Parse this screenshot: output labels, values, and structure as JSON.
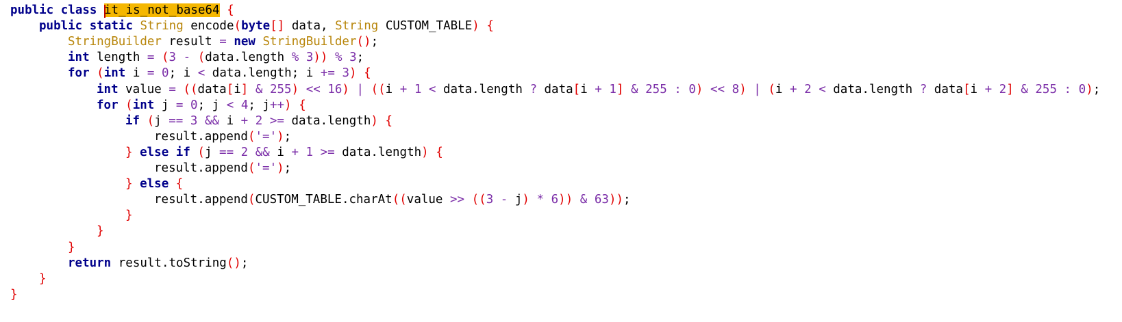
{
  "editor": {
    "lines": [
      {
        "indent": 0,
        "tokens": [
          [
            "kw",
            "public"
          ],
          [
            "id",
            " "
          ],
          [
            "kw",
            "class"
          ],
          [
            "id",
            " "
          ],
          [
            "hl",
            "it_is_not_base64"
          ],
          [
            "id",
            " "
          ],
          [
            "p",
            "{"
          ]
        ]
      },
      {
        "indent": 1,
        "tokens": [
          [
            "kw",
            "public"
          ],
          [
            "id",
            " "
          ],
          [
            "kw",
            "static"
          ],
          [
            "id",
            " "
          ],
          [
            "type",
            "String"
          ],
          [
            "id",
            " encode"
          ],
          [
            "p",
            "("
          ],
          [
            "kw",
            "byte"
          ],
          [
            "p",
            "[]"
          ],
          [
            "id",
            " data, "
          ],
          [
            "type",
            "String"
          ],
          [
            "id",
            " CUSTOM_TABLE"
          ],
          [
            "p",
            ")"
          ],
          [
            "id",
            " "
          ],
          [
            "p",
            "{"
          ]
        ]
      },
      {
        "indent": 2,
        "tokens": [
          [
            "type",
            "StringBuilder"
          ],
          [
            "id",
            " result "
          ],
          [
            "op",
            "="
          ],
          [
            "id",
            " "
          ],
          [
            "kw",
            "new"
          ],
          [
            "id",
            " "
          ],
          [
            "type",
            "StringBuilder"
          ],
          [
            "p",
            "()"
          ],
          [
            "id",
            ";"
          ]
        ]
      },
      {
        "indent": 2,
        "tokens": [
          [
            "kw",
            "int"
          ],
          [
            "id",
            " length "
          ],
          [
            "op",
            "="
          ],
          [
            "id",
            " "
          ],
          [
            "p",
            "("
          ],
          [
            "num",
            "3"
          ],
          [
            "id",
            " "
          ],
          [
            "op",
            "-"
          ],
          [
            "id",
            " "
          ],
          [
            "p",
            "("
          ],
          [
            "id",
            "data.length "
          ],
          [
            "op",
            "%"
          ],
          [
            "id",
            " "
          ],
          [
            "num",
            "3"
          ],
          [
            "p",
            "))"
          ],
          [
            "id",
            " "
          ],
          [
            "op",
            "%"
          ],
          [
            "id",
            " "
          ],
          [
            "num",
            "3"
          ],
          [
            "id",
            ";"
          ]
        ]
      },
      {
        "indent": 2,
        "tokens": [
          [
            "kw",
            "for"
          ],
          [
            "id",
            " "
          ],
          [
            "p",
            "("
          ],
          [
            "kw",
            "int"
          ],
          [
            "id",
            " i "
          ],
          [
            "op",
            "="
          ],
          [
            "id",
            " "
          ],
          [
            "num",
            "0"
          ],
          [
            "id",
            "; i "
          ],
          [
            "op",
            "<"
          ],
          [
            "id",
            " data.length; i "
          ],
          [
            "op",
            "+="
          ],
          [
            "id",
            " "
          ],
          [
            "num",
            "3"
          ],
          [
            "p",
            ")"
          ],
          [
            "id",
            " "
          ],
          [
            "p",
            "{"
          ]
        ]
      },
      {
        "indent": 3,
        "tokens": [
          [
            "kw",
            "int"
          ],
          [
            "id",
            " value "
          ],
          [
            "op",
            "="
          ],
          [
            "id",
            " "
          ],
          [
            "p",
            "(("
          ],
          [
            "id",
            "data"
          ],
          [
            "p",
            "["
          ],
          [
            "id",
            "i"
          ],
          [
            "p",
            "]"
          ],
          [
            "id",
            " "
          ],
          [
            "op",
            "&"
          ],
          [
            "id",
            " "
          ],
          [
            "num",
            "255"
          ],
          [
            "p",
            ")"
          ],
          [
            "id",
            " "
          ],
          [
            "op",
            "<<"
          ],
          [
            "id",
            " "
          ],
          [
            "num",
            "16"
          ],
          [
            "p",
            ")"
          ],
          [
            "id",
            " "
          ],
          [
            "op",
            "|"
          ],
          [
            "id",
            " "
          ],
          [
            "p",
            "(("
          ],
          [
            "id",
            "i "
          ],
          [
            "op",
            "+"
          ],
          [
            "id",
            " "
          ],
          [
            "num",
            "1"
          ],
          [
            "id",
            " "
          ],
          [
            "op",
            "<"
          ],
          [
            "id",
            " data.length "
          ],
          [
            "op",
            "?"
          ],
          [
            "id",
            " data"
          ],
          [
            "p",
            "["
          ],
          [
            "id",
            "i "
          ],
          [
            "op",
            "+"
          ],
          [
            "id",
            " "
          ],
          [
            "num",
            "1"
          ],
          [
            "p",
            "]"
          ],
          [
            "id",
            " "
          ],
          [
            "op",
            "&"
          ],
          [
            "id",
            " "
          ],
          [
            "num",
            "255"
          ],
          [
            "id",
            " "
          ],
          [
            "op",
            ":"
          ],
          [
            "id",
            " "
          ],
          [
            "num",
            "0"
          ],
          [
            "p",
            ")"
          ],
          [
            "id",
            " "
          ],
          [
            "op",
            "<<"
          ],
          [
            "id",
            " "
          ],
          [
            "num",
            "8"
          ],
          [
            "p",
            ")"
          ],
          [
            "id",
            " "
          ],
          [
            "op",
            "|"
          ],
          [
            "id",
            " "
          ],
          [
            "p",
            "("
          ],
          [
            "id",
            "i "
          ],
          [
            "op",
            "+"
          ],
          [
            "id",
            " "
          ],
          [
            "num",
            "2"
          ],
          [
            "id",
            " "
          ],
          [
            "op",
            "<"
          ],
          [
            "id",
            " data.length "
          ],
          [
            "op",
            "?"
          ],
          [
            "id",
            " data"
          ],
          [
            "p",
            "["
          ],
          [
            "id",
            "i "
          ],
          [
            "op",
            "+"
          ],
          [
            "id",
            " "
          ],
          [
            "num",
            "2"
          ],
          [
            "p",
            "]"
          ],
          [
            "id",
            " "
          ],
          [
            "op",
            "&"
          ],
          [
            "id",
            " "
          ],
          [
            "num",
            "255"
          ],
          [
            "id",
            " "
          ],
          [
            "op",
            ":"
          ],
          [
            "id",
            " "
          ],
          [
            "num",
            "0"
          ],
          [
            "p",
            ")"
          ],
          [
            "id",
            ";"
          ]
        ]
      },
      {
        "indent": 3,
        "tokens": [
          [
            "kw",
            "for"
          ],
          [
            "id",
            " "
          ],
          [
            "p",
            "("
          ],
          [
            "kw",
            "int"
          ],
          [
            "id",
            " j "
          ],
          [
            "op",
            "="
          ],
          [
            "id",
            " "
          ],
          [
            "num",
            "0"
          ],
          [
            "id",
            "; j "
          ],
          [
            "op",
            "<"
          ],
          [
            "id",
            " "
          ],
          [
            "num",
            "4"
          ],
          [
            "id",
            "; j"
          ],
          [
            "op",
            "++"
          ],
          [
            "p",
            ")"
          ],
          [
            "id",
            " "
          ],
          [
            "p",
            "{"
          ]
        ]
      },
      {
        "indent": 4,
        "tokens": [
          [
            "kw",
            "if"
          ],
          [
            "id",
            " "
          ],
          [
            "p",
            "("
          ],
          [
            "id",
            "j "
          ],
          [
            "op",
            "=="
          ],
          [
            "id",
            " "
          ],
          [
            "num",
            "3"
          ],
          [
            "id",
            " "
          ],
          [
            "op",
            "&&"
          ],
          [
            "id",
            " i "
          ],
          [
            "op",
            "+"
          ],
          [
            "id",
            " "
          ],
          [
            "num",
            "2"
          ],
          [
            "id",
            " "
          ],
          [
            "op",
            ">="
          ],
          [
            "id",
            " data.length"
          ],
          [
            "p",
            ")"
          ],
          [
            "id",
            " "
          ],
          [
            "p",
            "{"
          ]
        ]
      },
      {
        "indent": 5,
        "tokens": [
          [
            "id",
            "result.append"
          ],
          [
            "p",
            "("
          ],
          [
            "str",
            "'='"
          ],
          [
            "p",
            ")"
          ],
          [
            "id",
            ";"
          ]
        ]
      },
      {
        "indent": 4,
        "tokens": [
          [
            "p",
            "}"
          ],
          [
            "id",
            " "
          ],
          [
            "kw",
            "else"
          ],
          [
            "id",
            " "
          ],
          [
            "kw",
            "if"
          ],
          [
            "id",
            " "
          ],
          [
            "p",
            "("
          ],
          [
            "id",
            "j "
          ],
          [
            "op",
            "=="
          ],
          [
            "id",
            " "
          ],
          [
            "num",
            "2"
          ],
          [
            "id",
            " "
          ],
          [
            "op",
            "&&"
          ],
          [
            "id",
            " i "
          ],
          [
            "op",
            "+"
          ],
          [
            "id",
            " "
          ],
          [
            "num",
            "1"
          ],
          [
            "id",
            " "
          ],
          [
            "op",
            ">="
          ],
          [
            "id",
            " data.length"
          ],
          [
            "p",
            ")"
          ],
          [
            "id",
            " "
          ],
          [
            "p",
            "{"
          ]
        ]
      },
      {
        "indent": 5,
        "tokens": [
          [
            "id",
            "result.append"
          ],
          [
            "p",
            "("
          ],
          [
            "str",
            "'='"
          ],
          [
            "p",
            ")"
          ],
          [
            "id",
            ";"
          ]
        ]
      },
      {
        "indent": 4,
        "tokens": [
          [
            "p",
            "}"
          ],
          [
            "id",
            " "
          ],
          [
            "kw",
            "else"
          ],
          [
            "id",
            " "
          ],
          [
            "p",
            "{"
          ]
        ]
      },
      {
        "indent": 5,
        "tokens": [
          [
            "id",
            "result.append"
          ],
          [
            "p",
            "("
          ],
          [
            "id",
            "CUSTOM_TABLE.charAt"
          ],
          [
            "p",
            "(("
          ],
          [
            "id",
            "value "
          ],
          [
            "op",
            ">>"
          ],
          [
            "id",
            " "
          ],
          [
            "p",
            "(("
          ],
          [
            "num",
            "3"
          ],
          [
            "id",
            " "
          ],
          [
            "op",
            "-"
          ],
          [
            "id",
            " j"
          ],
          [
            "p",
            ")"
          ],
          [
            "id",
            " "
          ],
          [
            "op",
            "*"
          ],
          [
            "id",
            " "
          ],
          [
            "num",
            "6"
          ],
          [
            "p",
            "))"
          ],
          [
            "id",
            " "
          ],
          [
            "op",
            "&"
          ],
          [
            "id",
            " "
          ],
          [
            "num",
            "63"
          ],
          [
            "p",
            "))"
          ],
          [
            "id",
            ";"
          ]
        ]
      },
      {
        "indent": 4,
        "tokens": [
          [
            "p",
            "}"
          ]
        ]
      },
      {
        "indent": 3,
        "tokens": [
          [
            "p",
            "}"
          ]
        ]
      },
      {
        "indent": 2,
        "tokens": [
          [
            "p",
            "}"
          ]
        ]
      },
      {
        "indent": 2,
        "tokens": [
          [
            "kw",
            "return"
          ],
          [
            "id",
            " result.toString"
          ],
          [
            "p",
            "()"
          ],
          [
            "id",
            ";"
          ]
        ]
      },
      {
        "indent": 1,
        "tokens": [
          [
            "p",
            "}"
          ]
        ]
      },
      {
        "indent": 0,
        "tokens": [
          [
            "p",
            "}"
          ]
        ]
      }
    ]
  },
  "colors": {
    "keyword": "#00008b",
    "type": "#b8860b",
    "number": "#7b2ea8",
    "operator": "#7b2ea8",
    "paren": "#e00000",
    "highlight": "#f5b700",
    "caret": "#c00000"
  }
}
